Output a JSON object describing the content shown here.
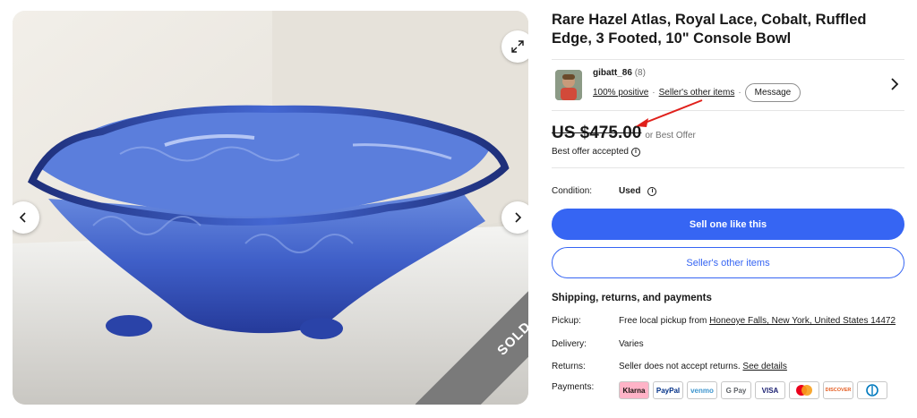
{
  "listing": {
    "title": "Rare Hazel Atlas, Royal Lace, Cobalt, Ruffled Edge, 3 Footed, 10\" Console Bowl",
    "sold_label": "SOLD"
  },
  "seller": {
    "name": "gibatt_86",
    "count": "(8)",
    "positive": "100% positive",
    "other_items_link": "Seller's other items",
    "message_label": "Message"
  },
  "price": {
    "amount": "US $475.00",
    "offer_note": "or Best Offer",
    "accepted": "Best offer accepted"
  },
  "condition": {
    "label": "Condition:",
    "value": "Used"
  },
  "actions": {
    "sell_label": "Sell one like this",
    "other_items_label": "Seller's other items"
  },
  "shipping": {
    "heading": "Shipping, returns, and payments",
    "pickup_label": "Pickup:",
    "pickup_prefix": "Free local pickup from ",
    "pickup_location": "Honeoye Falls, New York, United States 14472",
    "delivery_label": "Delivery:",
    "delivery_value": "Varies",
    "returns_label": "Returns:",
    "returns_value": "Seller does not accept returns. ",
    "returns_link": "See details",
    "payments_label": "Payments:"
  },
  "payments": [
    {
      "name": "Klarna",
      "bg": "#ffb3c7",
      "color": "#17120f"
    },
    {
      "name": "PayPal",
      "bg": "#ffffff",
      "color": "#003087"
    },
    {
      "name": "venmo",
      "bg": "#ffffff",
      "color": "#3d95ce"
    },
    {
      "name": "G Pay",
      "bg": "#ffffff",
      "color": "#5f6368"
    },
    {
      "name": "VISA",
      "bg": "#ffffff",
      "color": "#1a1f71"
    },
    {
      "name": "Mastercard",
      "bg": "#ffffff",
      "color": "#eb001b"
    },
    {
      "name": "DISCOVER",
      "bg": "#ffffff",
      "color": "#e55c20"
    },
    {
      "name": "Diners",
      "bg": "#ffffff",
      "color": "#0079be"
    }
  ],
  "colors": {
    "accent": "#3665f3",
    "sold_ribbon": "#7a7a7a",
    "annotation_arrow": "#e0201b"
  }
}
